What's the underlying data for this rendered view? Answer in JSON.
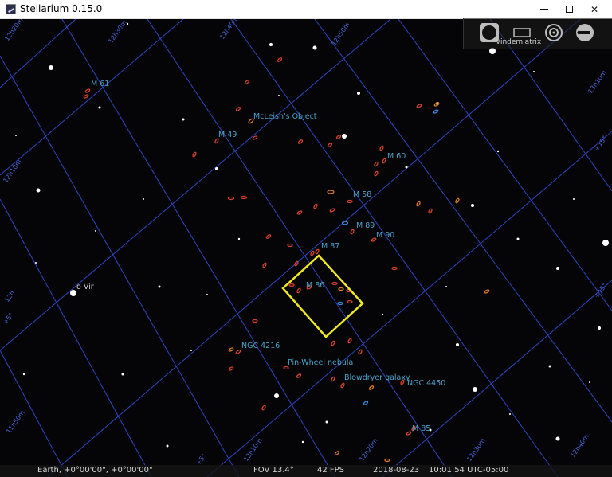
{
  "window": {
    "title": "Stellarium 0.15.0",
    "minimize_glyph": "",
    "maximize_glyph": "",
    "close_glyph": "✕"
  },
  "top_panel": {
    "label": "Vindemiatrix",
    "buttons": [
      "planet-icon",
      "screen-icon",
      "target-icon",
      "goto-icon"
    ]
  },
  "objects": {
    "m61": "M 61",
    "mcleish": "McLeish's Object",
    "m49": "M 49",
    "m60": "M 60",
    "m58": "M 58",
    "m89": "M 89",
    "m90": "M 90",
    "m87": "M 87",
    "m86": "M 86",
    "ngc4216": "NGC 4216",
    "pinwheel": "Pin-Wheel nebula",
    "blowdryer": "Blowdryer galaxy",
    "ngc4450": "NGC 4450",
    "m85": "M 85",
    "o_vir": "o Vir"
  },
  "grid_labels": {
    "ra_12h20m": "12h20m",
    "ra_12h30m": "12h30m",
    "ra_12h40m": "12h40m",
    "ra_12h50m": "12h50m",
    "ra_13h0m": "13h0m",
    "ra_13h10m": "13h10m",
    "ra_12h10m": "12h10m",
    "ra_12h": "12h",
    "ra_11h50m": "11h50m",
    "dec_5": "+5°",
    "dec_10": "+10°",
    "dec_15": "+15°"
  },
  "status": {
    "location": "Earth, +0°00'00\", +0°00'00\"",
    "fov": "FOV 13.4°",
    "fps": "42 FPS",
    "date": "2018-08-23",
    "time": "10:01:54 UTC-05:00"
  },
  "colors": {
    "sky": "#050508",
    "grid": "#2f46c0",
    "object_label": "#4ba2c8",
    "nebula_marker": "#d8402a",
    "selection_box": "#f0e822"
  }
}
